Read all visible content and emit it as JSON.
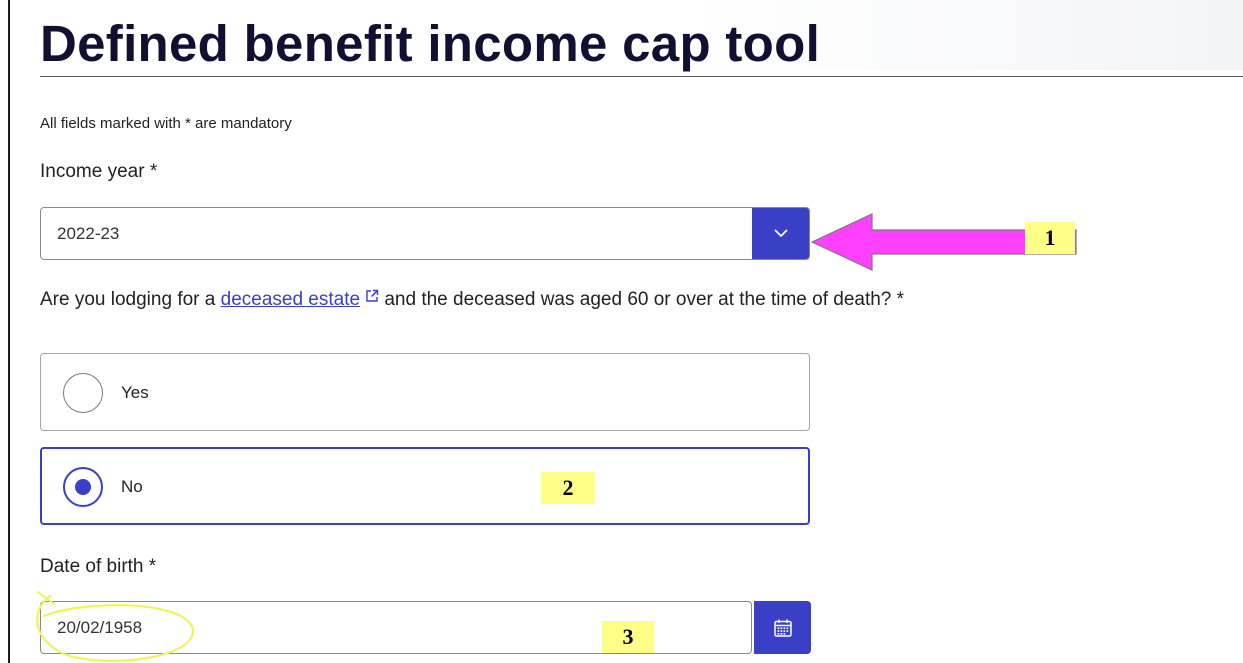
{
  "page": {
    "title": "Defined benefit income cap tool",
    "mandatory_note": "All fields marked with * are mandatory"
  },
  "income_year": {
    "label": "Income year *",
    "selected_value": "2022-23",
    "button_icon": "chevron-down-icon"
  },
  "deceased_question": {
    "text_before": "Are you lodging for a ",
    "link_text": "deceased estate",
    "link_icon": "external-link-icon",
    "text_after": " and the deceased was aged 60 or over at the time of death? *",
    "options": [
      {
        "label": "Yes",
        "selected": false
      },
      {
        "label": "No",
        "selected": true
      }
    ]
  },
  "date_of_birth": {
    "label": "Date of birth *",
    "value": "20/02/1958",
    "button_icon": "calendar-icon"
  },
  "annotations": {
    "badges": [
      "1",
      "2",
      "3"
    ],
    "arrow_color": "#ff40ff",
    "highlight_color": "#ffff88",
    "ellipse_color": "#f2f25a"
  },
  "colors": {
    "accent": "#3a3fc7",
    "title": "#121032"
  }
}
